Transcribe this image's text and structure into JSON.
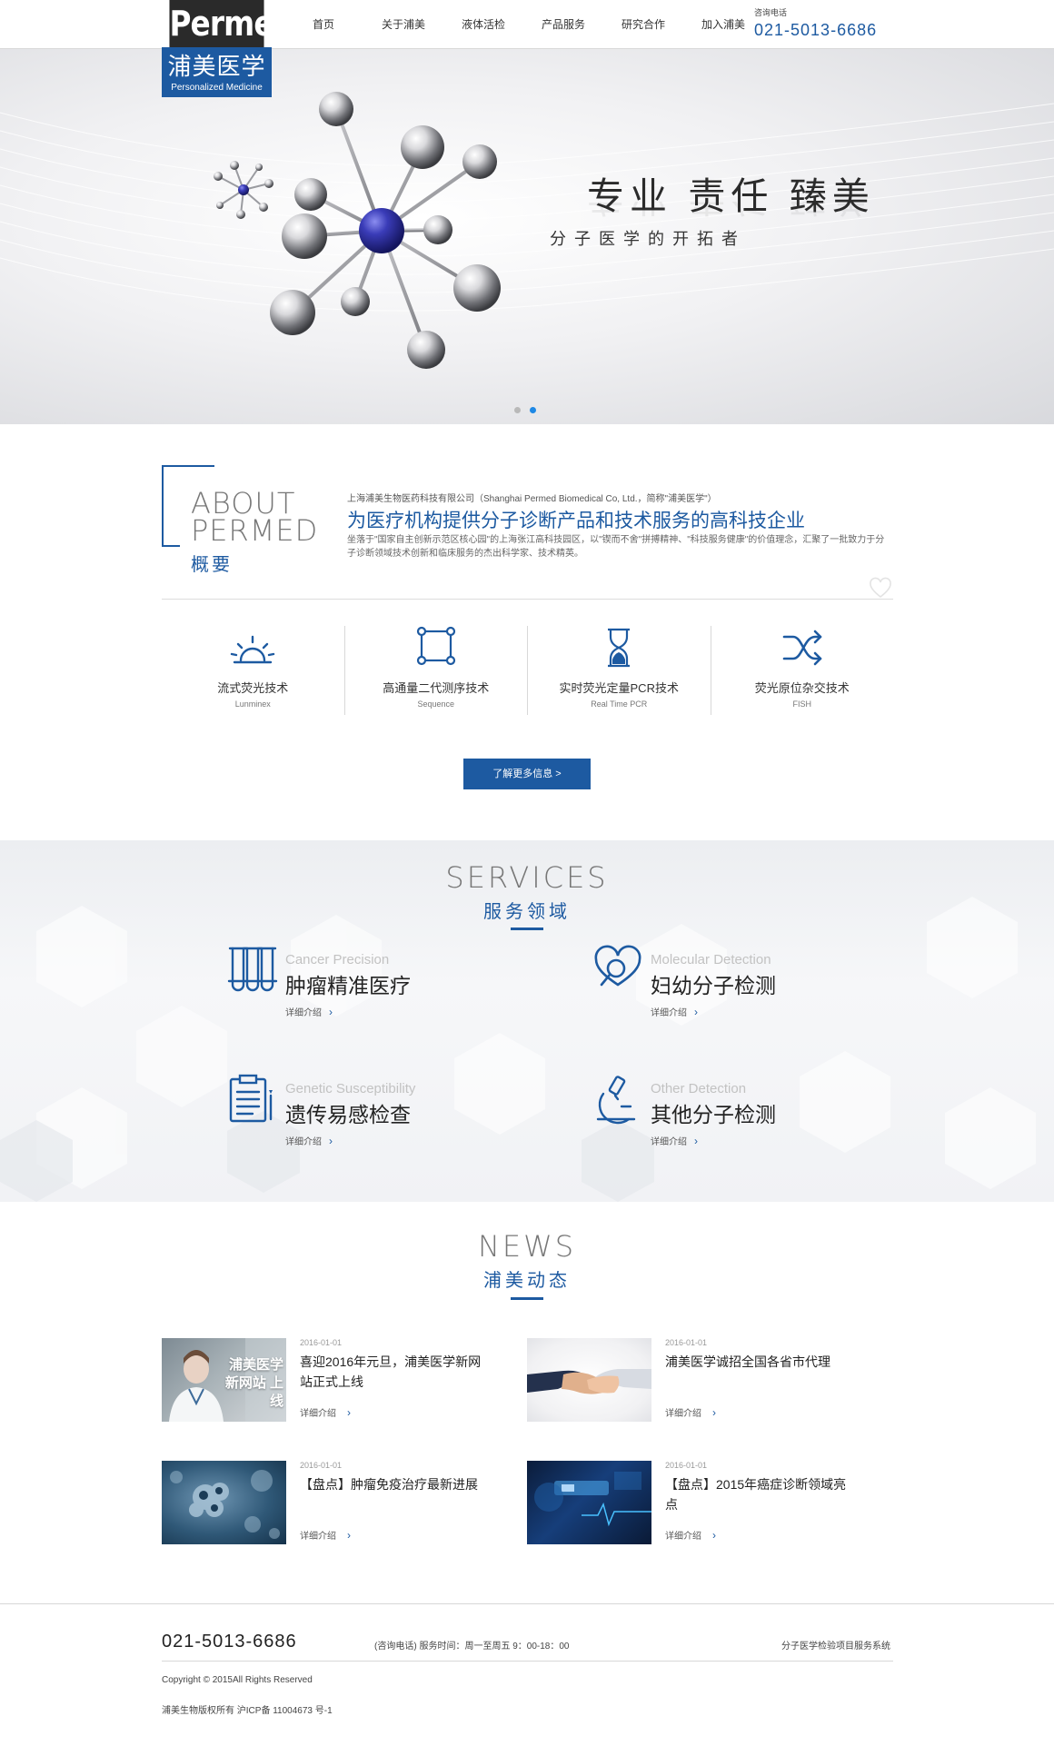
{
  "brand": {
    "logo_en": "Permed",
    "logo_cn": "浦美医学",
    "logo_tagline": "Personalized Medicine",
    "primary_color": "#1d5aa1",
    "accent_dot_color": "#1e88e5"
  },
  "nav": {
    "items": [
      {
        "label": "首页"
      },
      {
        "label": "关于浦美"
      },
      {
        "label": "液体活检"
      },
      {
        "label": "产品服务"
      },
      {
        "label": "研究合作"
      },
      {
        "label": "加入浦美"
      }
    ]
  },
  "contact": {
    "label": "咨询电话",
    "phone": "021-5013-6686"
  },
  "hero": {
    "title": "专业 责任 臻美",
    "subtitle": "分子医学的开拓者",
    "slide_count": 2,
    "active_slide": 2
  },
  "about": {
    "title_line1": "ABOUT",
    "title_line2": "PERMED",
    "title_cn": "概要",
    "company": "上海浦美生物医药科技有限公司（Shanghai Permed Biomedical Co, Ltd.，简称\"浦美医学\"）",
    "headline": "为医疗机构提供分子诊断产品和技术服务的高科技企业",
    "description": "坐落于\"国家自主创新示范区核心园\"的上海张江高科技园区，以\"锲而不舍\"拼搏精神、\"科技服务健康\"的价值理念，汇聚了一批致力于分子诊断领域技术创新和临床服务的杰出科学家、技术精英。",
    "technologies": [
      {
        "cn": "流式荧光技术",
        "en": "Lunminex",
        "icon": "sunrise-icon"
      },
      {
        "cn": "高通量二代测序技术",
        "en": "Sequence",
        "icon": "nodes-square-icon"
      },
      {
        "cn": "实时荧光定量PCR技术",
        "en": "Real Time PCR",
        "icon": "hourglass-icon"
      },
      {
        "cn": "荧光原位杂交技术",
        "en": "FISH",
        "icon": "shuffle-icon"
      }
    ],
    "more_button": "了解更多信息 >"
  },
  "services": {
    "title_en": "SERVICES",
    "title_cn": "服务领域",
    "link_label": "详细介绍",
    "items": [
      {
        "en": "Cancer Precision",
        "cn": "肿瘤精准医疗",
        "icon": "test-tubes-icon"
      },
      {
        "en": "Molecular Detection",
        "cn": "妇幼分子检测",
        "icon": "heart-magnifier-icon"
      },
      {
        "en": "Genetic Susceptibility",
        "cn": "遗传易感检查",
        "icon": "clipboard-icon"
      },
      {
        "en": "Other Detection",
        "cn": "其他分子检测",
        "icon": "microscope-icon"
      }
    ]
  },
  "news": {
    "title_en": "NEWS",
    "title_cn": "浦美动态",
    "link_label": "详细介绍",
    "items": [
      {
        "date": "2016-01-01",
        "title": "喜迎2016年元旦，浦美医学新网站正式上线",
        "thumb_text": "浦美医学 新网站 上线"
      },
      {
        "date": "2016-01-01",
        "title": "浦美医学诚招全国各省市代理"
      },
      {
        "date": "2016-01-01",
        "title": "【盘点】肿瘤免疫治疗最新进展"
      },
      {
        "date": "2016-01-01",
        "title": "【盘点】2015年癌症诊断领域亮点"
      }
    ]
  },
  "footer": {
    "phone": "021-5013-6686",
    "hours": "(咨询电话) 服务时间：周一至周五 9：00-18：00",
    "system": "分子医学检验项目服务系统",
    "copyright": "Copyright © 2015All Rights Reserved",
    "icp": "浦美生物版权所有 沪ICP备 11004673 号-1"
  }
}
